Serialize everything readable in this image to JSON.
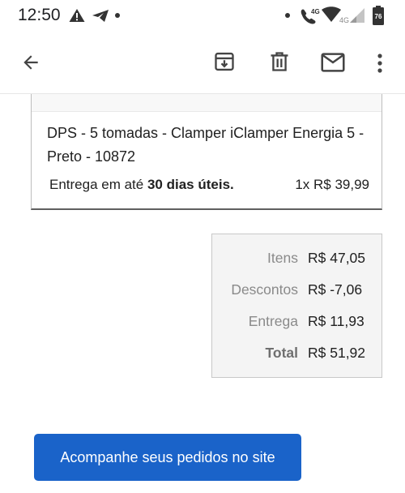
{
  "status_bar": {
    "time": "12:50",
    "icons": [
      "warning-icon",
      "telegram-icon",
      "dot-icon",
      "dot-icon",
      "wifi-call-icon",
      "wifi-icon",
      "signal-icon",
      "battery-icon"
    ],
    "volte_label": "4G",
    "network_label": "4G",
    "battery_level": "76"
  },
  "app_bar": {
    "icons": [
      "back-arrow-icon",
      "archive-icon",
      "delete-icon",
      "mail-icon",
      "more-vert-icon"
    ]
  },
  "order_item": {
    "name": "DPS - 5 tomadas - Clamper iClamper Energia 5 - Preto - 10872",
    "delivery_prefix": "Entrega em até ",
    "delivery_days": "30 dias úteis.",
    "qty_price": "1x R$ 39,99"
  },
  "summary": {
    "rows": [
      {
        "label": "Itens",
        "value": "R$ 47,05"
      },
      {
        "label": "Descontos",
        "value": "R$ -7,06"
      },
      {
        "label": "Entrega",
        "value": "R$ 11,93"
      },
      {
        "label": "Total",
        "value": "R$ 51,92"
      }
    ]
  },
  "cta_label": "Acompanhe seus pedidos no site",
  "colors": {
    "primary_button": "#1a63c9",
    "text": "#212121",
    "muted": "#8a8a8a"
  }
}
